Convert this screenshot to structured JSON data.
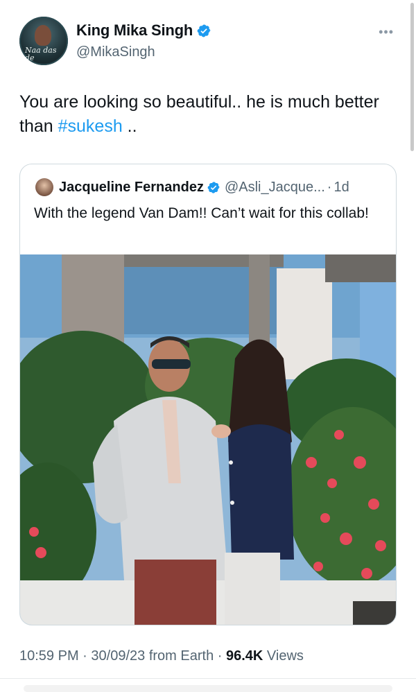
{
  "author": {
    "name": "King Mika Singh",
    "handle": "@MikaSingh",
    "avatar_caption": "Naa das de",
    "avatar_icon": "profile-avatar",
    "verified_color": "#1d9bf0"
  },
  "tweet": {
    "text_before": "You are looking so beautiful.. he is much better than ",
    "hashtag": "#sukesh",
    "text_after": " .."
  },
  "quoted_tweet": {
    "name": "Jacqueline Fernandez",
    "handle": "@Asli_Jacque...",
    "separator": "·",
    "age": "1d",
    "text": "With the legend Van Dam!! Can’t wait for this collab!"
  },
  "meta": {
    "time": "10:59 PM",
    "date": "30/09/23",
    "source": "from Earth",
    "views_count": "96.4K",
    "views_label": "Views"
  },
  "colors": {
    "link": "#1d9bf0",
    "muted": "#536471",
    "text": "#0f1419",
    "border": "#cfd9de"
  }
}
